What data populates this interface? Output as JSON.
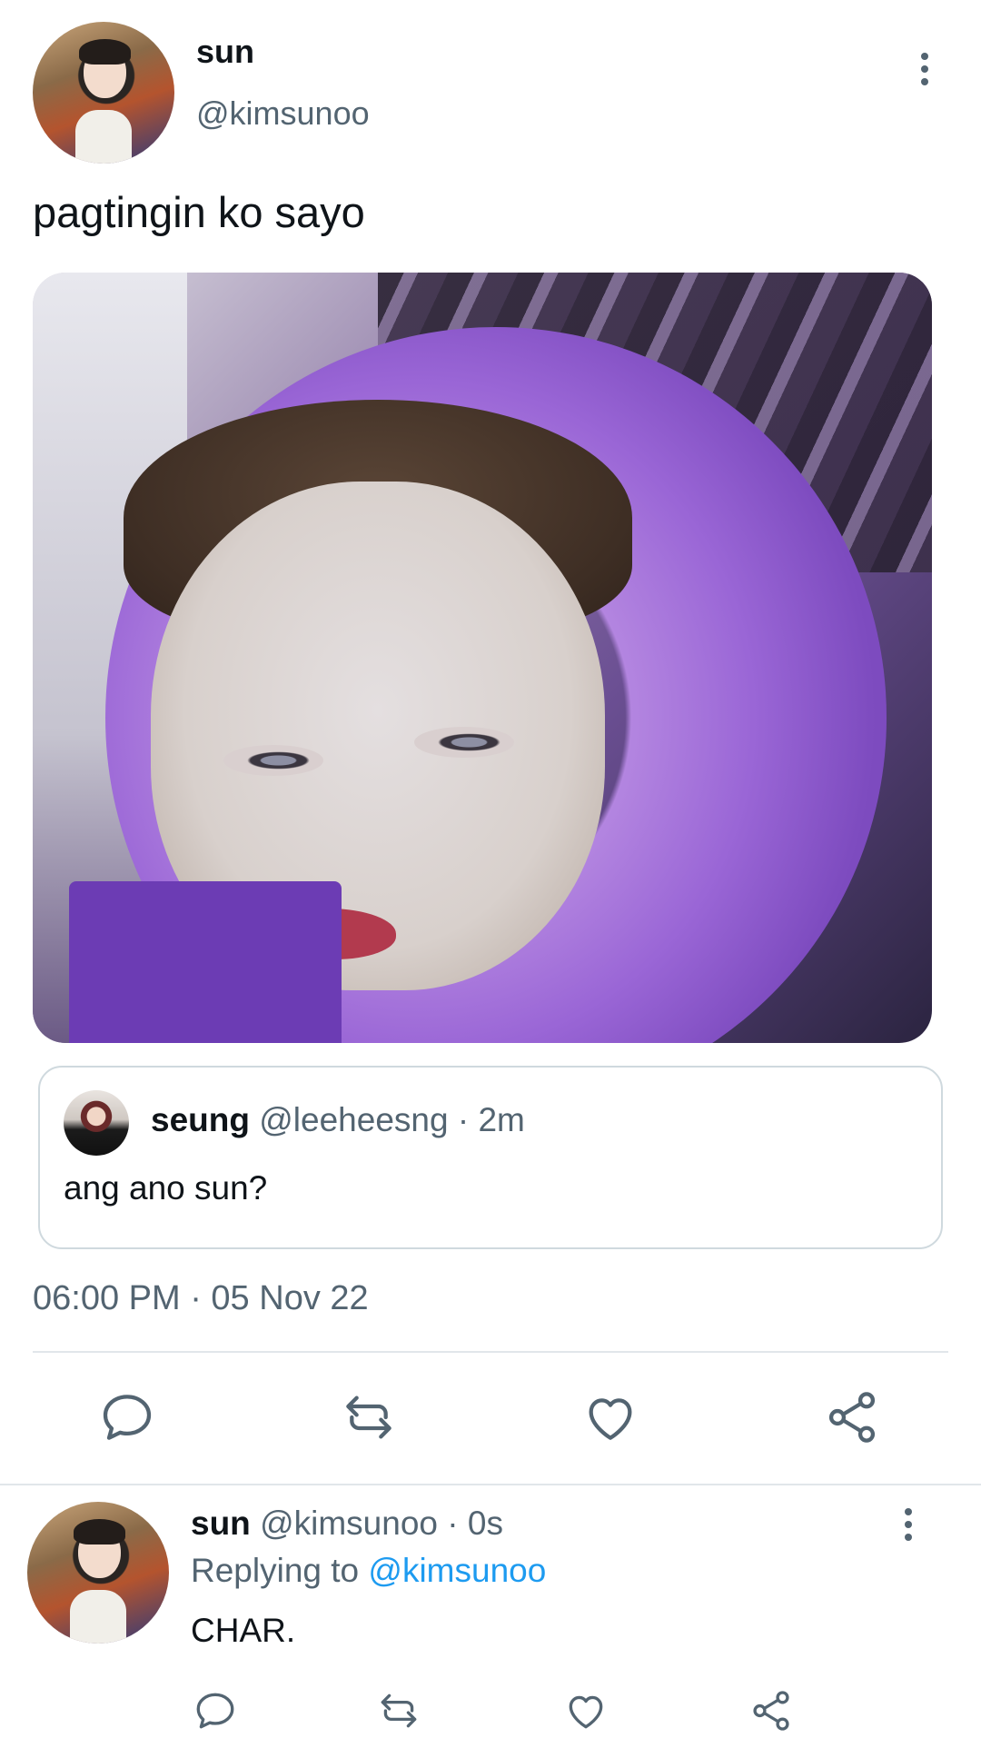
{
  "main_tweet": {
    "display_name": "sun",
    "handle": "@kimsunoo",
    "text": "pagtingin ko sayo",
    "timestamp": "06:00 PM · 05 Nov 22"
  },
  "quoted_tweet": {
    "display_name": "seung",
    "handle": "@leeheesng",
    "separator": " · ",
    "time": "2m",
    "text": "ang ano sun?"
  },
  "reply": {
    "display_name": "sun",
    "handle": "@kimsunoo",
    "separator": " · ",
    "time": "0s",
    "replying_prefix": "Replying to ",
    "replying_to": "@kimsunoo",
    "text": "CHAR."
  },
  "icons": [
    "more-vertical-icon",
    "reply-icon",
    "retweet-icon",
    "like-icon",
    "share-icon"
  ],
  "colors": {
    "text_primary": "#0f1419",
    "text_secondary": "#536471",
    "link": "#1d9bf0",
    "border": "#cfd9de"
  }
}
